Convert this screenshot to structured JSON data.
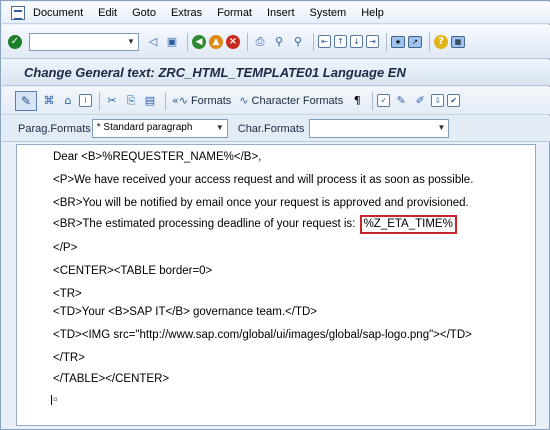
{
  "menu": {
    "items": [
      "Document",
      "Edit",
      "Goto",
      "Extras",
      "Format",
      "Insert",
      "System",
      "Help"
    ]
  },
  "title": "Change General text: ZRC_HTML_TEMPLATE01 Language EN",
  "app_toolbar": {
    "formats_label": "Formats",
    "char_formats_label": "Character Formats"
  },
  "format_row": {
    "parag_label": "Parag.Formats",
    "parag_value": "* Standard paragraph",
    "char_label": "Char.Formats",
    "char_value": ""
  },
  "editor": {
    "lines": [
      "Dear <B>%REQUESTER_NAME%</B>,",
      "<P>We have received your access request and will process it as soon as possible.",
      "<BR>You will be notified by email once your request is approved and provisioned.",
      "<BR>The estimated processing deadline of your request is: ",
      "</P>",
      "<CENTER><TABLE border=0>",
      "<TR>",
      "<TD>Your <B>SAP IT</B> governance team.</TD>",
      "<TD><IMG src=\"http://www.sap.com/global/ui/images/global/sap-logo.png\"></TD>",
      "</TR>",
      "</TABLE></CENTER>"
    ],
    "highlighted_variable": "%Z_ETA_TIME%"
  },
  "colors": {
    "highlight_border": "#c8242c",
    "title_text": "#1b2b44"
  }
}
